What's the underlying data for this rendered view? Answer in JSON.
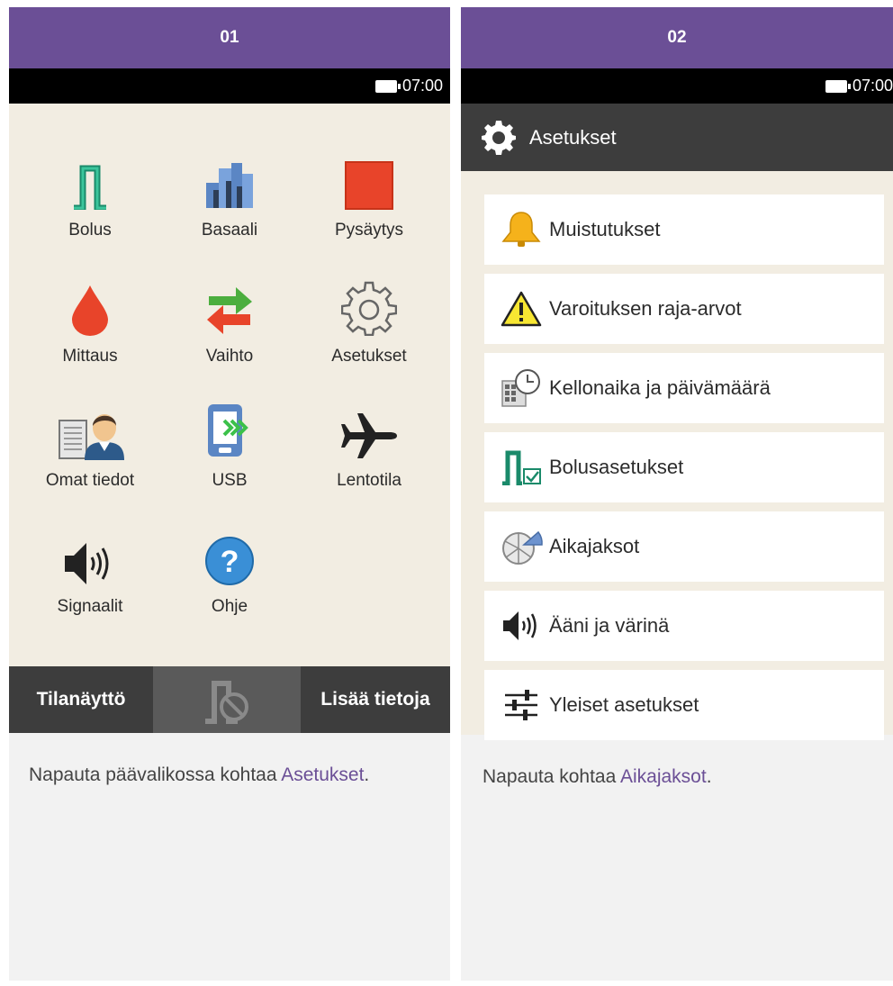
{
  "steps": [
    {
      "number": "01",
      "status": {
        "time": "07:00"
      },
      "tiles": [
        {
          "label": "Bolus",
          "icon": "bolus-icon"
        },
        {
          "label": "Basaali",
          "icon": "basal-chart-icon"
        },
        {
          "label": "Pysäytys",
          "icon": "stop-icon"
        },
        {
          "label": "Mittaus",
          "icon": "blood-drop-icon"
        },
        {
          "label": "Vaihto",
          "icon": "swap-arrows-icon"
        },
        {
          "label": "Asetukset",
          "icon": "gear-icon"
        },
        {
          "label": "Omat tiedot",
          "icon": "profile-icon"
        },
        {
          "label": "USB",
          "icon": "usb-device-icon"
        },
        {
          "label": "Lentotila",
          "icon": "airplane-icon"
        },
        {
          "label": "Signaalit",
          "icon": "speaker-icon"
        },
        {
          "label": "Ohje",
          "icon": "help-icon"
        }
      ],
      "bottombar": {
        "left": "Tilanäyttö",
        "right": "Lisää tietoja"
      },
      "caption": {
        "prefix": "Napauta päävalikossa kohtaa ",
        "link": "Asetukset",
        "suffix": "."
      }
    },
    {
      "number": "02",
      "status": {
        "time": "07:00"
      },
      "title": "Asetukset",
      "menu": [
        {
          "label": "Muistutukset",
          "icon": "bell-icon"
        },
        {
          "label": "Varoituksen raja-arvot",
          "icon": "warning-icon"
        },
        {
          "label": "Kellonaika ja päivämäärä",
          "icon": "calendar-clock-icon"
        },
        {
          "label": "Bolusasetukset",
          "icon": "bolus-settings-icon"
        },
        {
          "label": "Aikajaksot",
          "icon": "time-blocks-icon"
        },
        {
          "label": "Ääni ja värinä",
          "icon": "speaker-icon"
        },
        {
          "label": "Yleiset asetukset",
          "icon": "sliders-icon"
        }
      ],
      "caption": {
        "prefix": "Napauta kohtaa ",
        "link": "Aikajaksot",
        "suffix": "."
      }
    }
  ],
  "colors": {
    "header": "#6b4f96",
    "screen_bg": "#f2ede2",
    "bar_dark": "#3d3d3d"
  }
}
